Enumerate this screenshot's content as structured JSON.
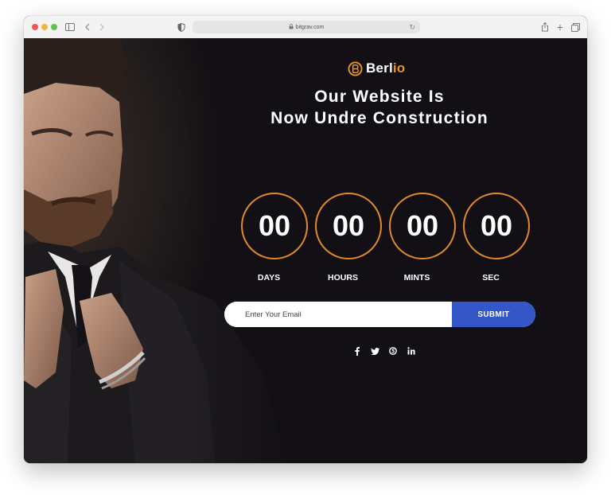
{
  "browser": {
    "url": "bitgrav.com"
  },
  "brand": {
    "name_main": "Berl",
    "name_accent": "io"
  },
  "headline": {
    "line1": "Our Website Is",
    "line2": "Now Undre Construction"
  },
  "countdown": [
    {
      "value": "00",
      "label": "DAYS"
    },
    {
      "value": "00",
      "label": "HOURS"
    },
    {
      "value": "00",
      "label": "MINTS"
    },
    {
      "value": "00",
      "label": "SEC"
    }
  ],
  "subscribe": {
    "email_placeholder": "Enter Your Email",
    "email_value": "",
    "submit_label": "SUBMIT"
  },
  "social": [
    {
      "icon": "facebook-icon",
      "glyph": "f"
    },
    {
      "icon": "twitter-icon",
      "glyph": "t"
    },
    {
      "icon": "skype-icon",
      "glyph": "s"
    },
    {
      "icon": "linkedin-icon",
      "glyph": "in"
    }
  ],
  "colors": {
    "accent": "#e08a2c",
    "submit": "#3456c6",
    "background": "#121014"
  }
}
